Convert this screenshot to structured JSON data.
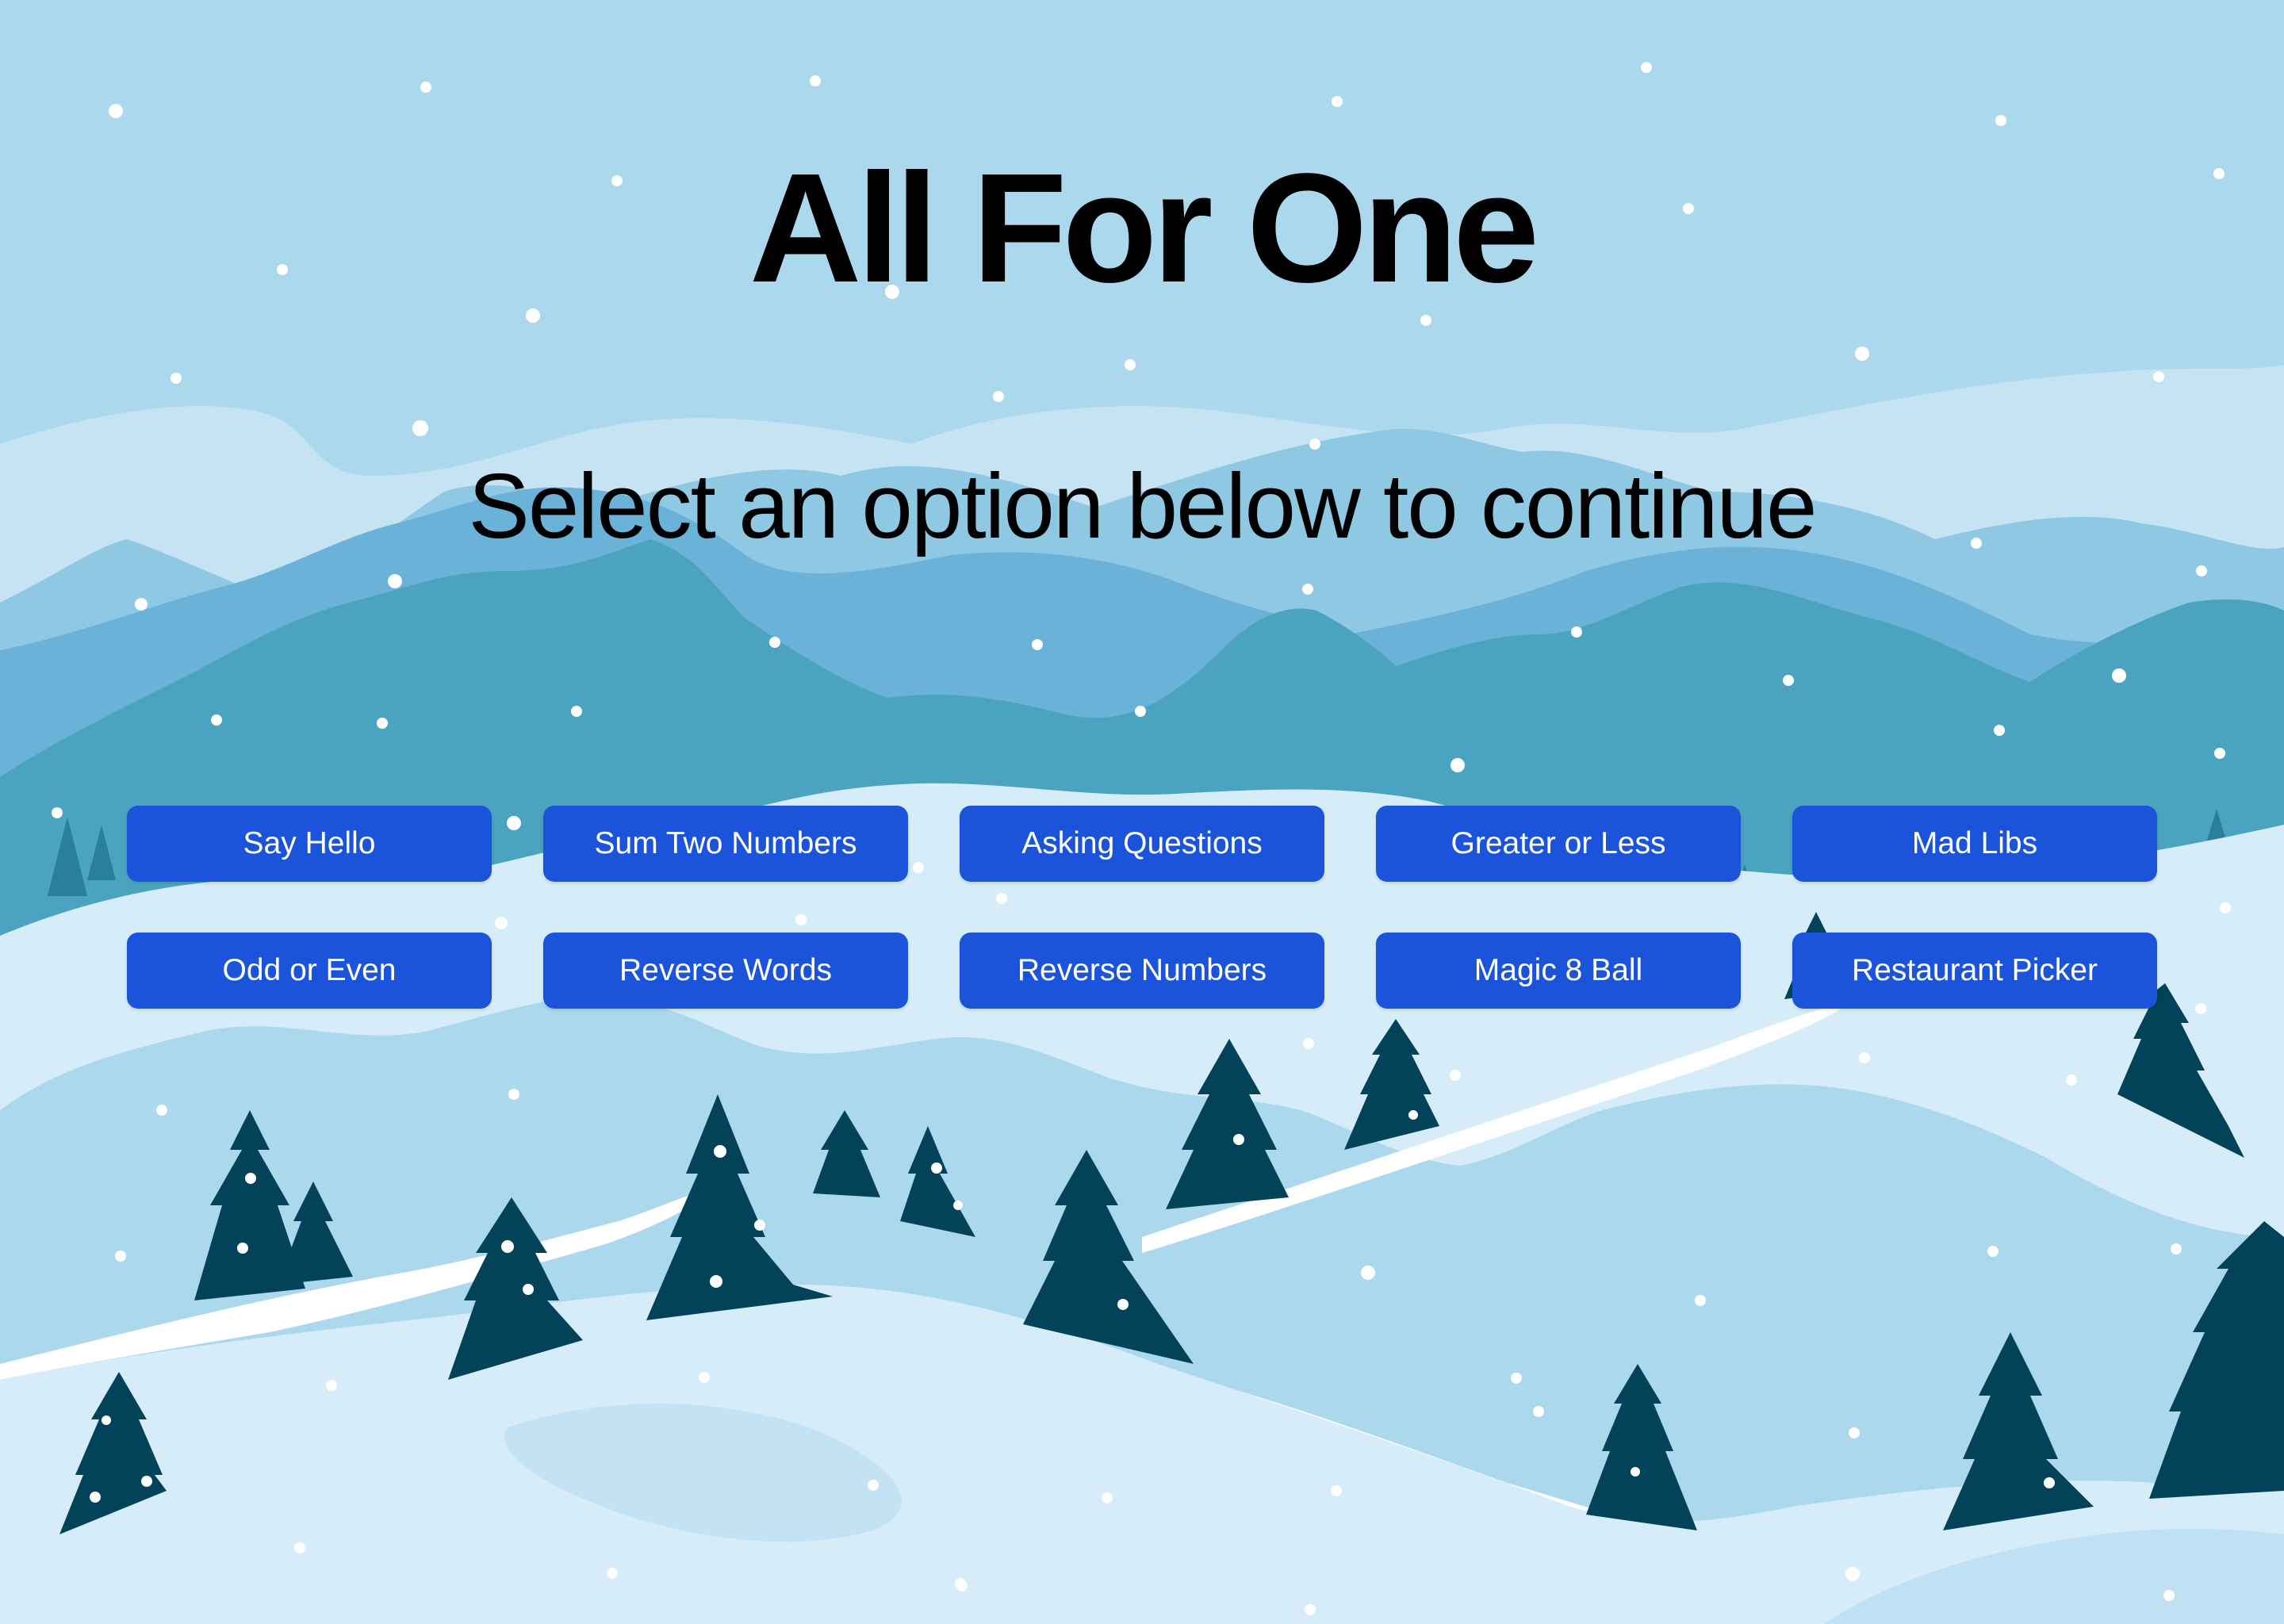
{
  "header": {
    "title": "All For One",
    "subtitle": "Select an option below to continue"
  },
  "options": [
    {
      "label": "Say Hello"
    },
    {
      "label": "Sum Two Numbers"
    },
    {
      "label": "Asking Questions"
    },
    {
      "label": "Greater or Less"
    },
    {
      "label": "Mad Libs"
    },
    {
      "label": "Odd or Even"
    },
    {
      "label": "Reverse Words"
    },
    {
      "label": "Reverse Numbers"
    },
    {
      "label": "Magic 8 Ball"
    },
    {
      "label": "Restaurant Picker"
    }
  ],
  "colors": {
    "sky": "#acd8ee",
    "mountain_back": "#8ec8e3",
    "mountain_mid": "#6ab2d8",
    "mountain_front": "#4aa4bf",
    "snow_light": "#d6edf9",
    "snow_mid": "#bfe1f3",
    "tree": "#02435a",
    "button": "#1b54db",
    "button_text": "#ffffff"
  }
}
